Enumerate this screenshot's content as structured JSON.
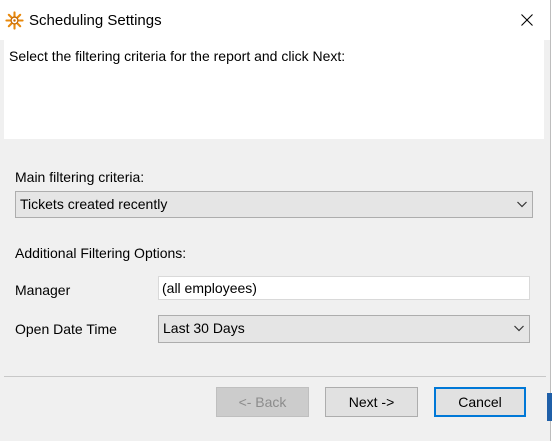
{
  "window": {
    "title": "Scheduling Settings",
    "icon": "sparkle-gear-icon",
    "close_glyph": "✕"
  },
  "header": {
    "instruction": "Select the filtering criteria for the report and click Next:"
  },
  "main_filter": {
    "label": "Main filtering criteria:",
    "selected": "Tickets created recently"
  },
  "additional": {
    "label": "Additional Filtering Options:",
    "manager_label": "Manager",
    "manager_value": "(all employees)",
    "open_date_label": "Open Date Time",
    "open_date_selected": "Last 30 Days"
  },
  "buttons": {
    "back": "<- Back",
    "next": "Next ->",
    "cancel": "Cancel"
  },
  "colors": {
    "accent": "#0078d7",
    "icon_orange": "#e8890c",
    "edge_blue": "#1f5fa8"
  }
}
